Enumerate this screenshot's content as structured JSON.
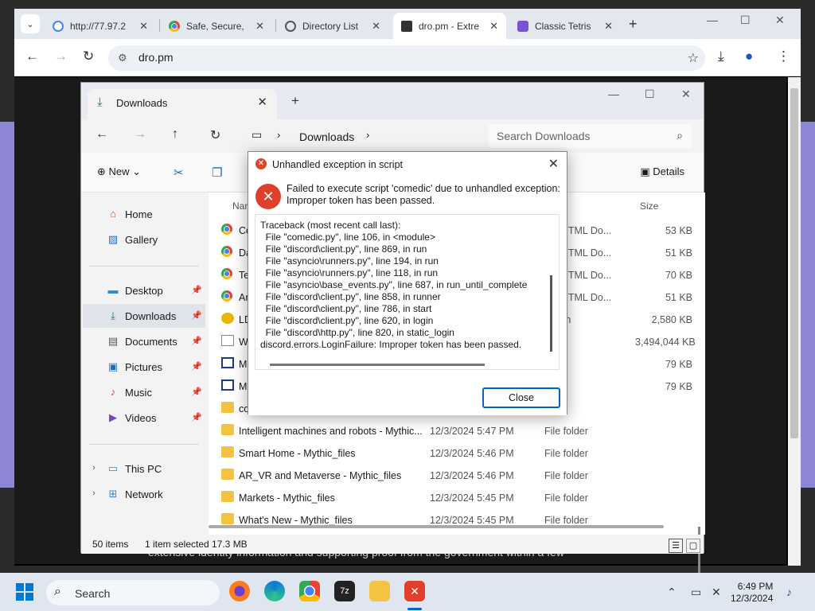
{
  "browser": {
    "tabs": [
      {
        "label": "http://77.97.2",
        "icon": "google-icon",
        "color": "#4285f4"
      },
      {
        "label": "Safe, Secure, ",
        "icon": "chrome-icon",
        "color": "#34a853"
      },
      {
        "label": "Directory List",
        "icon": "globe-icon",
        "color": "#555555"
      },
      {
        "label": "dro.pm - Extre",
        "icon": "dropm-icon",
        "color": "#333333"
      },
      {
        "label": "Classic Tetris",
        "icon": "tetris-icon",
        "color": "#7b4fd6"
      }
    ],
    "url": "dro.pm"
  },
  "page": {
    "caption": "extensive identity information and supporting proof from the government within a few"
  },
  "explorer": {
    "tab_title": "Downloads",
    "breadcrumb": "Downloads",
    "search_placeholder": "Search Downloads",
    "new_label": "New",
    "details_label": "Details",
    "sidebar": {
      "home": "Home",
      "gallery": "Gallery",
      "desktop": "Desktop",
      "downloads": "Downloads",
      "documents": "Documents",
      "pictures": "Pictures",
      "music": "Music",
      "videos": "Videos",
      "thispc": "This PC",
      "network": "Network"
    },
    "columns": {
      "name": "Nan",
      "size": "Size"
    },
    "files": [
      {
        "name": "Co",
        "date": "",
        "type": "me HTML Do...",
        "size": "53 KB"
      },
      {
        "name": "Da",
        "date": "",
        "type": "me HTML Do...",
        "size": "51 KB"
      },
      {
        "name": "Te",
        "date": "",
        "type": "me HTML Do...",
        "size": "70 KB"
      },
      {
        "name": "Ar",
        "date": "",
        "type": "me HTML Do...",
        "size": "51 KB"
      },
      {
        "name": "LD",
        "date": "",
        "type": "cation",
        "size": "2,580 KB"
      },
      {
        "name": "Wi",
        "date": "",
        "type": "iso",
        "size": "3,494,044 KB"
      },
      {
        "name": "Mi",
        "date": "",
        "type": "chive",
        "size": "79 KB"
      },
      {
        "name": "Mi",
        "date": "",
        "type": "chive",
        "size": "79 KB"
      },
      {
        "name": "co",
        "date": "",
        "type": "older",
        "size": ""
      },
      {
        "name": "Intelligent machines and robots - Mythic...",
        "date": "12/3/2024 5:47 PM",
        "type": "File folder",
        "size": ""
      },
      {
        "name": "Smart Home - Mythic_files",
        "date": "12/3/2024 5:46 PM",
        "type": "File folder",
        "size": ""
      },
      {
        "name": "AR_VR and Metaverse - Mythic_files",
        "date": "12/3/2024 5:46 PM",
        "type": "File folder",
        "size": ""
      },
      {
        "name": "Markets - Mythic_files",
        "date": "12/3/2024 5:45 PM",
        "type": "File folder",
        "size": ""
      },
      {
        "name": "What's New - Mythic_files",
        "date": "12/3/2024 5:45 PM",
        "type": "File folder",
        "size": ""
      }
    ],
    "status": {
      "count": "50 items",
      "selected": "1 item selected",
      "size": "17.3 MB"
    }
  },
  "dialog": {
    "title": "Unhandled exception in script",
    "message": "Failed to execute script 'comedic' due to unhandled exception:\nImproper token has been passed.",
    "traceback": "Traceback (most recent call last):\n  File \"comedic.py\", line 106, in <module>\n  File \"discord\\client.py\", line 869, in run\n  File \"asyncio\\runners.py\", line 194, in run\n  File \"asyncio\\runners.py\", line 118, in run\n  File \"asyncio\\base_events.py\", line 687, in run_until_complete\n  File \"discord\\client.py\", line 858, in runner\n  File \"discord\\client.py\", line 786, in start\n  File \"discord\\client.py\", line 620, in login\n  File \"discord\\http.py\", line 820, in static_login\ndiscord.errors.LoginFailure: Improper token has been passed.",
    "close_label": "Close"
  },
  "taskbar": {
    "search_label": "Search",
    "time": "6:49 PM",
    "date": "12/3/2024"
  }
}
